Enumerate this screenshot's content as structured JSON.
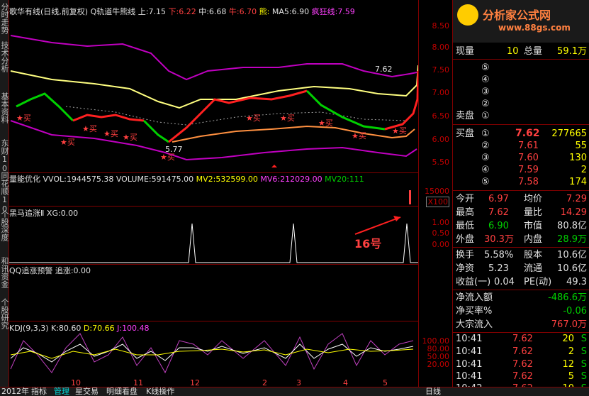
{
  "header": {
    "title": "歌华有线(日线,前复权)",
    "indicator": "Q轨道牛熊线",
    "up_label": "上:",
    "up_value": "7.15",
    "down_label": "下:",
    "down_value": "6.22",
    "mid_label": "中:",
    "mid_value": "6.68",
    "bull_label": "牛:",
    "bull_value": "6.70",
    "bear_label": "熊:",
    "ma5_label": "MA5:",
    "ma5_value": "6.90",
    "crazy_label": "疯狂线:",
    "crazy_value": "7.59"
  },
  "logo": {
    "line1": "分析家公式网",
    "line2": "www.88gs.com"
  },
  "price_axis": [
    "8.50",
    "8.00",
    "7.50",
    "7.00",
    "6.50",
    "6.00",
    "5.50"
  ],
  "price_annotations": {
    "high": "7.62",
    "low": "5.77"
  },
  "buy_markers": [
    "★买",
    "★买",
    "★买",
    "★买",
    "★买",
    "★买",
    "★买",
    "★买",
    "★买",
    "★买",
    "★买"
  ],
  "volume_panel": {
    "name": "量能优化",
    "vvol_label": "VVOL:",
    "vvol_value": "1944575.38",
    "volume_label": "VOLUME:",
    "volume_value": "591475.00",
    "mv2_label": "MV2:",
    "mv2_value": "532599.00",
    "mv6_label": "MV6:",
    "mv6_value": "212029.00",
    "mv20_label": "MV20:",
    "mv20_value": "111",
    "axis_top": "15000",
    "axis_unit": "X100"
  },
  "horse_panel": {
    "name": "黑马追涨Ⅱ",
    "xg_label": "XG:",
    "xg_value": "0.00",
    "axis": [
      "1.00",
      "0.50",
      "0.00"
    ],
    "annotation": "16号"
  },
  "qq_panel": {
    "name": "QQ追涨预警",
    "label": "追涨:",
    "value": "0.00"
  },
  "kdj_panel": {
    "name": "KDJ(9,3,3)",
    "k_label": "K:",
    "k_value": "80.60",
    "d_label": "D:",
    "d_value": "70.66",
    "j_label": "J:",
    "j_value": "100.48",
    "axis": [
      "100.00",
      "80.00",
      "50.00",
      "20.00"
    ]
  },
  "left_tabs": [
    "分时走势",
    "技术分析",
    "基本资料",
    "东财10",
    "同花顺10",
    "个股深度",
    "和讯资金",
    "个股研究"
  ],
  "bottom_tabs": [
    "2012年",
    "指标",
    "管理",
    "星交易",
    "明细看盘",
    "K线操作"
  ],
  "bottom_months": [
    "10",
    "11",
    "12",
    "2",
    "3",
    "4",
    "5"
  ],
  "period": "日线",
  "quote": {
    "now_label": "现量",
    "now_value": "10",
    "total_label": "总量",
    "total_value": "59.1万",
    "sell_label": "卖盘",
    "sell_nums": [
      "⑤",
      "④",
      "③",
      "②",
      "①"
    ],
    "buy_label": "买盘",
    "buy_nums": [
      "①",
      "②",
      "③",
      "④",
      "⑤"
    ],
    "buy_prices": [
      "7.62",
      "7.61",
      "7.60",
      "7.59",
      "7.58"
    ],
    "buy_vols": [
      "277665",
      "55",
      "130",
      "2",
      "174"
    ]
  },
  "stats": [
    {
      "l1": "今开",
      "v1": "6.97",
      "l2": "均价",
      "v2": "7.29"
    },
    {
      "l1": "最高",
      "v1": "7.62",
      "l2": "量比",
      "v2": "14.29"
    },
    {
      "l1": "最低",
      "v1": "6.90",
      "l2": "市值",
      "v2": "80.8亿"
    },
    {
      "l1": "外盘",
      "v1": "30.3万",
      "l2": "内盘",
      "v2": "28.9万"
    },
    {
      "l1": "换手",
      "v1": "5.58%",
      "l2": "股本",
      "v2": "10.6亿"
    },
    {
      "l1": "净资",
      "v1": "5.23",
      "l2": "流通",
      "v2": "10.6亿"
    },
    {
      "l1": "收益(一)",
      "v1": "0.04",
      "l2": "PE(动)",
      "v2": "49.3"
    }
  ],
  "flow": [
    {
      "label": "净流入额",
      "value": "-486.6万"
    },
    {
      "label": "净买率%",
      "value": "-0.06"
    },
    {
      "label": "大宗流入",
      "value": "767.0万"
    }
  ],
  "ticks": [
    {
      "time": "10:41",
      "price": "7.62",
      "vol": "20",
      "side": "S"
    },
    {
      "time": "10:41",
      "price": "7.62",
      "vol": "2",
      "side": "S"
    },
    {
      "time": "10:41",
      "price": "7.62",
      "vol": "12",
      "side": "S"
    },
    {
      "time": "10:41",
      "price": "7.62",
      "vol": "5",
      "side": "S"
    },
    {
      "time": "10:42",
      "price": "7.62",
      "vol": "10",
      "side": "S"
    }
  ],
  "colors": {
    "bg": "#000000",
    "grid": "#800000",
    "up": "#ff4040",
    "down": "#00d000",
    "upper_rail": "#c000c0",
    "mid_rail": "#ffff80",
    "lower_rail": "#ff9040"
  }
}
